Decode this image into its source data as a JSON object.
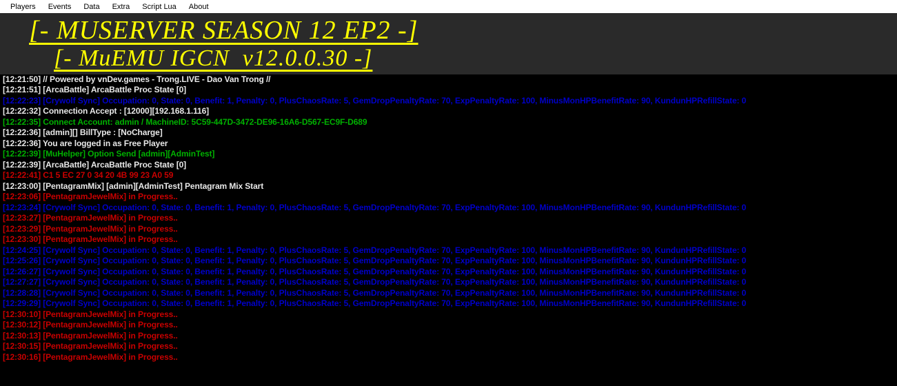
{
  "menu": {
    "items": [
      "Players",
      "Events",
      "Data",
      "Extra",
      "Script Lua",
      "About"
    ]
  },
  "banner": {
    "line1": "[- MUSERVER SEASON 12 EP2 -]",
    "line2": "[- MuEMU IGCN  v12.0.0.30 -]"
  },
  "log": {
    "lines": [
      {
        "ts": "[12:21:50]",
        "color": "white",
        "text": "// Powered by vnDev.games - Trong.LIVE - Dao Van Trong //"
      },
      {
        "ts": "[12:21:51]",
        "color": "white",
        "text": "[ArcaBattle] ArcaBattle Proc State [0]"
      },
      {
        "ts": "[12:22:23]",
        "color": "blue",
        "text": "[Crywolf Sync] Occupation: 0, State: 0, Benefit: 1, Penalty: 0, PlusChaosRate: 5, GemDropPenaltyRate: 70, ExpPenaltyRate: 100, MinusMonHPBenefitRate: 90, KundunHPRefillState: 0"
      },
      {
        "ts": "[12:22:32]",
        "color": "white",
        "text": "Connection Accept : [12000][192.168.1.116]"
      },
      {
        "ts": "[12:22:35]",
        "color": "green",
        "text": "Connect Account: admin / MachineID: 5C59-447D-3472-DE96-16A6-D567-EC9F-D689"
      },
      {
        "ts": "[12:22:36]",
        "color": "white",
        "text": "[admin][] BillType : [NoCharge]"
      },
      {
        "ts": "[12:22:36]",
        "color": "white",
        "text": "You are logged in as Free Player"
      },
      {
        "ts": "[12:22:39]",
        "color": "green",
        "text": "[MuHelper] Option Send [admin][AdminTest]"
      },
      {
        "ts": "[12:22:39]",
        "color": "white",
        "text": "[ArcaBattle] ArcaBattle Proc State [0]"
      },
      {
        "ts": "[12:22:41]",
        "color": "red",
        "text": "C1 5 EC 27 0 34 20 4B 99 23 A0 59"
      },
      {
        "ts": "[12:23:00]",
        "color": "white",
        "text": "[PentagramMix] [admin][AdminTest] Pentagram Mix Start"
      },
      {
        "ts": "[12:23:06]",
        "color": "red",
        "text": "[PentagramJewelMix] in Progress.."
      },
      {
        "ts": "[12:23:24]",
        "color": "blue",
        "text": "[Crywolf Sync] Occupation: 0, State: 0, Benefit: 1, Penalty: 0, PlusChaosRate: 5, GemDropPenaltyRate: 70, ExpPenaltyRate: 100, MinusMonHPBenefitRate: 90, KundunHPRefillState: 0"
      },
      {
        "ts": "[12:23:27]",
        "color": "red",
        "text": "[PentagramJewelMix] in Progress.."
      },
      {
        "ts": "[12:23:29]",
        "color": "red",
        "text": "[PentagramJewelMix] in Progress.."
      },
      {
        "ts": "[12:23:30]",
        "color": "red",
        "text": "[PentagramJewelMix] in Progress.."
      },
      {
        "ts": "[12:24:25]",
        "color": "blue",
        "text": "[Crywolf Sync] Occupation: 0, State: 0, Benefit: 1, Penalty: 0, PlusChaosRate: 5, GemDropPenaltyRate: 70, ExpPenaltyRate: 100, MinusMonHPBenefitRate: 90, KundunHPRefillState: 0"
      },
      {
        "ts": "[12:25:26]",
        "color": "blue",
        "text": "[Crywolf Sync] Occupation: 0, State: 0, Benefit: 1, Penalty: 0, PlusChaosRate: 5, GemDropPenaltyRate: 70, ExpPenaltyRate: 100, MinusMonHPBenefitRate: 90, KundunHPRefillState: 0"
      },
      {
        "ts": "[12:26:27]",
        "color": "blue",
        "text": "[Crywolf Sync] Occupation: 0, State: 0, Benefit: 1, Penalty: 0, PlusChaosRate: 5, GemDropPenaltyRate: 70, ExpPenaltyRate: 100, MinusMonHPBenefitRate: 90, KundunHPRefillState: 0"
      },
      {
        "ts": "[12:27:27]",
        "color": "blue",
        "text": "[Crywolf Sync] Occupation: 0, State: 0, Benefit: 1, Penalty: 0, PlusChaosRate: 5, GemDropPenaltyRate: 70, ExpPenaltyRate: 100, MinusMonHPBenefitRate: 90, KundunHPRefillState: 0"
      },
      {
        "ts": "[12:28:28]",
        "color": "blue",
        "text": "[Crywolf Sync] Occupation: 0, State: 0, Benefit: 1, Penalty: 0, PlusChaosRate: 5, GemDropPenaltyRate: 70, ExpPenaltyRate: 100, MinusMonHPBenefitRate: 90, KundunHPRefillState: 0"
      },
      {
        "ts": "[12:29:29]",
        "color": "blue",
        "text": "[Crywolf Sync] Occupation: 0, State: 0, Benefit: 1, Penalty: 0, PlusChaosRate: 5, GemDropPenaltyRate: 70, ExpPenaltyRate: 100, MinusMonHPBenefitRate: 90, KundunHPRefillState: 0"
      },
      {
        "ts": "[12:30:10]",
        "color": "red",
        "text": "[PentagramJewelMix] in Progress.."
      },
      {
        "ts": "[12:30:12]",
        "color": "red",
        "text": "[PentagramJewelMix] in Progress.."
      },
      {
        "ts": "[12:30:13]",
        "color": "red",
        "text": "[PentagramJewelMix] in Progress.."
      },
      {
        "ts": "[12:30:15]",
        "color": "red",
        "text": "[PentagramJewelMix] in Progress.."
      },
      {
        "ts": "[12:30:16]",
        "color": "red",
        "text": "[PentagramJewelMix] in Progress.."
      }
    ]
  },
  "colors": {
    "white": "#e8e8e8",
    "green": "#00b000",
    "blue": "#0000c8",
    "red": "#c80000"
  }
}
